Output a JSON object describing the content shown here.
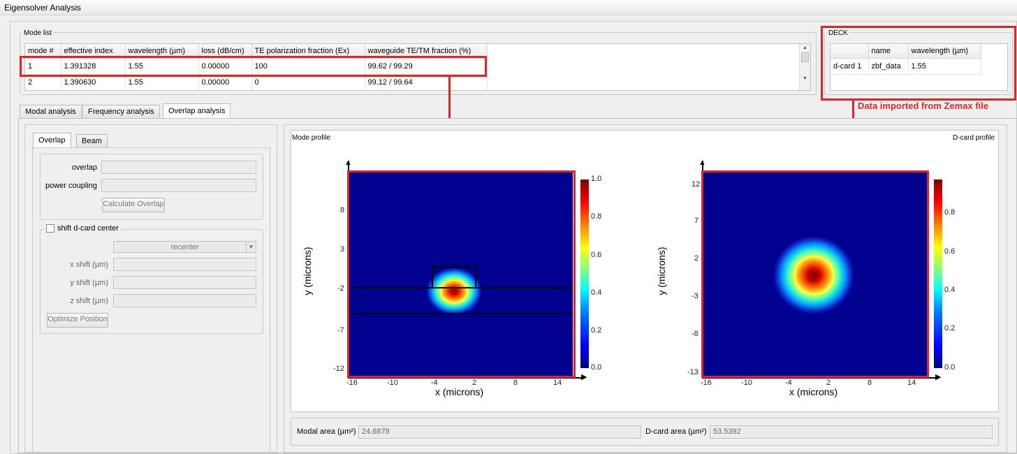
{
  "window": {
    "title": "Eigensolver Analysis"
  },
  "mode_list": {
    "label": "Mode list",
    "columns": [
      "mode #",
      "effective index",
      "wavelength (µm)",
      "loss (dB/cm)",
      "TE polarization fraction (Ex)",
      "waveguide TE/TM fraction (%)"
    ],
    "rows": [
      [
        "1",
        "1.391328",
        "1.55",
        "0.00000",
        "100",
        "99.62 / 99.29"
      ],
      [
        "2",
        "1.390630",
        "1.55",
        "0.00000",
        "0",
        "99.12 / 99.64"
      ]
    ]
  },
  "deck": {
    "label": "DECK",
    "columns": [
      "",
      "name",
      "wavelength (µm)"
    ],
    "rows": [
      [
        "d-card 1",
        "zbf_data",
        "1.55"
      ]
    ]
  },
  "annotation": "Data imported from Zemax file",
  "tabs": [
    "Modal analysis",
    "Frequency analysis",
    "Overlap analysis"
  ],
  "subtabs": [
    "Overlap",
    "Beam"
  ],
  "overlap": {
    "overlap_label": "overlap",
    "power_label": "power coupling",
    "calc_button": "Calculate Overlap",
    "shift_label": "shift d-card center",
    "recenter": "recenter",
    "x_shift": "x shift (µm)",
    "y_shift": "y shift (µm)",
    "z_shift": "z shift (µm)",
    "optimize_button": "Optimize Position"
  },
  "plots": {
    "mode_title": "Mode profile",
    "dcard_title": "D-card profile",
    "xlabel": "x (microns)",
    "ylabel": "y (microns)",
    "x_ticks": [
      "-16",
      "-10",
      "-4",
      "2",
      "8",
      "14"
    ],
    "mode_y_ticks": [
      "8",
      "3",
      "-2",
      "-7",
      "-12"
    ],
    "dcard_y_ticks": [
      "12",
      "7",
      "2",
      "-3",
      "-8",
      "-13"
    ],
    "mode_cbar_ticks": [
      "1.0",
      "0.8",
      "0.6",
      "0.4",
      "0.2",
      "0.0"
    ],
    "dcard_cbar_ticks": [
      "0.8",
      "0.6",
      "0.4",
      "0.2",
      "0.0"
    ]
  },
  "bottom": {
    "modal_area_label": "Modal area (µm²)",
    "modal_area_value": "24.6878",
    "dcard_area_label": "D-card area (µm²)",
    "dcard_area_value": "53.5392"
  },
  "colors": {
    "annotation_red": "#e0242c",
    "heatmap_bg": "#00008f"
  }
}
